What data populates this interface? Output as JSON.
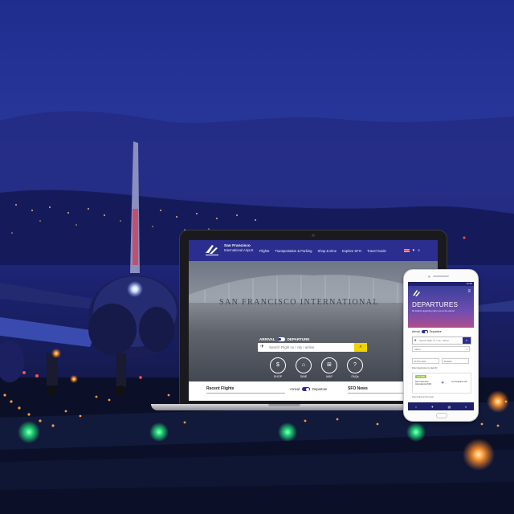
{
  "laptop_site": {
    "logo": {
      "line1": "San Francisco",
      "line2": "International Airport"
    },
    "nav": [
      "Flights",
      "Transportation & Parking",
      "Shop & Dine",
      "Explore SFO",
      "Travel Guide"
    ],
    "hero_title": "SAN FRANCISCO INTERNATIONAL",
    "toggle": {
      "arrival": "ARRIVAL",
      "departure": "DEPARTURE"
    },
    "search": {
      "placeholder": "Search Flight no / city / airline"
    },
    "quick_links": [
      {
        "icon": "dollar-icon",
        "glyph": "$",
        "label": "SHOP"
      },
      {
        "icon": "dine-icon",
        "glyph": "⌂",
        "label": "DINE"
      },
      {
        "icon": "map-icon",
        "glyph": "⊞",
        "label": "MAP"
      },
      {
        "icon": "faq-icon",
        "glyph": "?",
        "label": "FAQs"
      }
    ],
    "sections": {
      "recent": "Recent Flights",
      "arrival": "Arrival",
      "departure": "Departure",
      "news": "SFO News"
    }
  },
  "phone_app": {
    "status": "12:30",
    "title": "DEPARTURES",
    "subtitle": "83 Flights departing right now at the airport",
    "tabs": {
      "arrival": "Arrival",
      "departure": "Departure"
    },
    "search": {
      "placeholder": "Search flight no / city / airline"
    },
    "select1": "Airline",
    "select2": "All Terminals",
    "select3": "All Dates",
    "filter_text": "Filter departures by date ID",
    "card": {
      "badge": "ON TIME",
      "from": "San Francisco International SFO",
      "to": "Los Angeles LAX",
      "foot": "International Terminal"
    }
  },
  "colors": {
    "brand": "#2b2e8f",
    "accent": "#f0d400",
    "sky": "#1e2a8a"
  }
}
